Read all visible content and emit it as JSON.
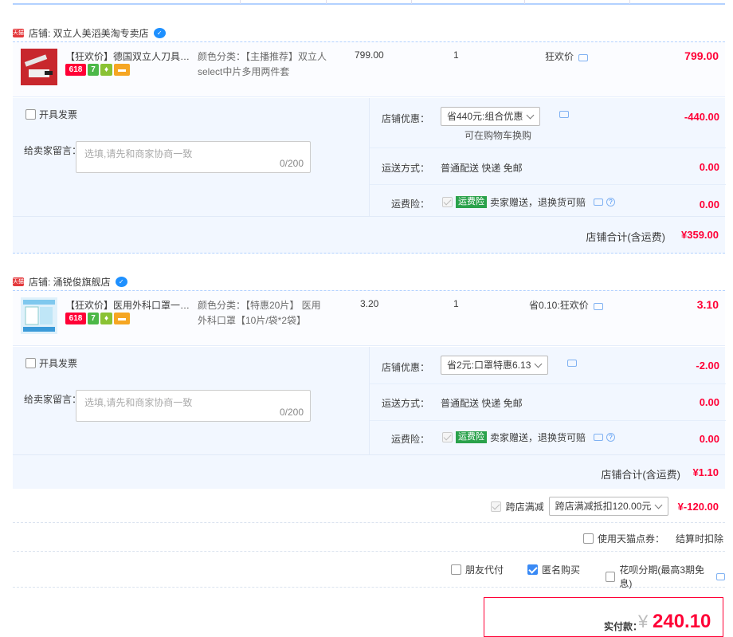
{
  "shops": [
    {
      "name": "店铺: 双立人美滔美淘专卖店",
      "item": {
        "title": "【狂欢价】德国双立人刀具套装...",
        "sku": "颜色分类：【主播推荐】双立人select中片多用两件套",
        "price": "799.00",
        "qty": "1",
        "promo": "狂欢价",
        "subtotal": "799.00"
      },
      "invoice": "开具发票",
      "memo_label": "给卖家留言：",
      "memo_placeholder": "选填,请先和商家协商一致",
      "memo_count": "0/200",
      "discount_label": "店铺优惠：",
      "discount_select": "省440元:组合优惠",
      "discount_hint": "可在购物车换购",
      "discount_value": "-440.00",
      "shipping_label": "运送方式：",
      "shipping_text": "普通配送 快递 免邮",
      "shipping_value": "0.00",
      "insurance_label": "运费险：",
      "insurance_tag": "运费险",
      "insurance_text": "卖家赠送，退换货可赔",
      "insurance_value": "0.00",
      "total_label": "店铺合计(含运费)",
      "total_value": "¥359.00"
    },
    {
      "name": "店铺: 涌锐俊旗舰店",
      "item": {
        "title": "【狂欢价】医用外科口罩一次性...",
        "sku": "颜色分类：【特惠20片】 医用外科口罩【10片/袋*2袋】",
        "price": "3.20",
        "qty": "1",
        "promo": "省0.10:狂欢价",
        "subtotal": "3.10"
      },
      "invoice": "开具发票",
      "memo_label": "给卖家留言：",
      "memo_placeholder": "选填,请先和商家协商一致",
      "memo_count": "0/200",
      "discount_label": "店铺优惠：",
      "discount_select": "省2元:口罩特惠6.13",
      "discount_value": "-2.00",
      "shipping_label": "运送方式：",
      "shipping_text": "普通配送 快递 免邮",
      "shipping_value": "0.00",
      "insurance_label": "运费险：",
      "insurance_tag": "运费险",
      "insurance_text": "卖家赠送，退换货可赔",
      "insurance_value": "0.00",
      "total_label": "店铺合计(含运费)",
      "total_value": "¥1.10"
    }
  ],
  "badges": [
    "618",
    "7",
    "",
    ""
  ],
  "cross_store": {
    "label": "跨店满减",
    "select": "跨店满减抵扣120.00元",
    "value": "¥-120.00"
  },
  "tmall_points": {
    "label": "使用天猫点券：",
    "note": "结算时扣除"
  },
  "options": {
    "friend_pay": "朋友代付",
    "anonymous": "匿名购买",
    "huabei": "花呗分期(最高3期免息)"
  },
  "payment": {
    "label": "实付款：",
    "currency": "¥",
    "amount": "240.10"
  },
  "colors": {
    "accent": "#ff0036",
    "blue": "#3a8af5",
    "panel": "#f2f7ff"
  }
}
